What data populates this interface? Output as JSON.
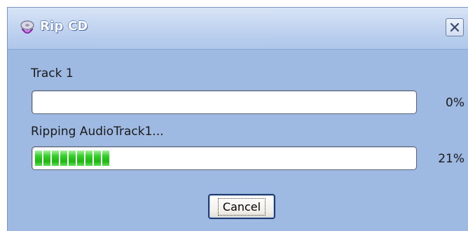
{
  "window": {
    "title": "Rip CD",
    "title_icon": "cd-rip-icon",
    "close_icon": "close-icon"
  },
  "track": {
    "label": "Track 1",
    "progress_text": "0%",
    "progress_value": 0
  },
  "ripping": {
    "status": "Ripping AudioTrack1...",
    "progress_text": "21%",
    "progress_value": 0.21
  },
  "buttons": {
    "cancel_label": "Cancel"
  },
  "colors": {
    "window_bg": "#9eb9e2",
    "titlebar": "#c3d5f0",
    "progress_fill": "#1fb414"
  }
}
